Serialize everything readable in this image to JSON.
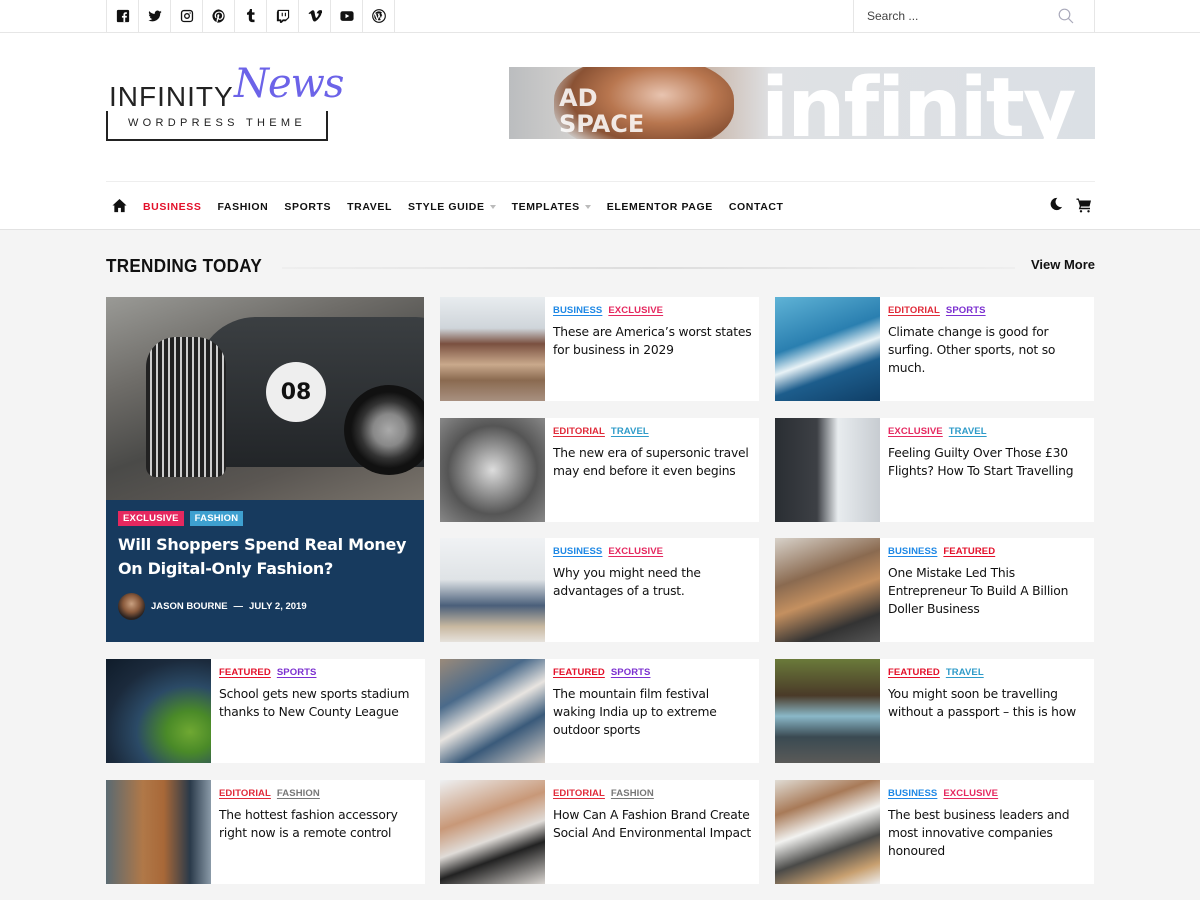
{
  "topbar": {
    "social": [
      {
        "name": "facebook-icon"
      },
      {
        "name": "twitter-icon"
      },
      {
        "name": "instagram-icon"
      },
      {
        "name": "pinterest-icon"
      },
      {
        "name": "tumblr-icon"
      },
      {
        "name": "twitch-icon"
      },
      {
        "name": "vimeo-icon"
      },
      {
        "name": "youtube-icon"
      },
      {
        "name": "wordpress-icon"
      }
    ],
    "search": {
      "placeholder": "Search ...",
      "icon": "search-icon"
    }
  },
  "logo": {
    "word1": "INFINITY",
    "word2": "News",
    "tagline": "WORDPRESS THEME"
  },
  "ad": {
    "line1": "AD",
    "line2": "SPACE",
    "brand": "infinity"
  },
  "nav": {
    "items": [
      {
        "label": "BUSINESS",
        "active": true,
        "dropdown": false
      },
      {
        "label": "FASHION",
        "active": false,
        "dropdown": false
      },
      {
        "label": "SPORTS",
        "active": false,
        "dropdown": false
      },
      {
        "label": "TRAVEL",
        "active": false,
        "dropdown": false
      },
      {
        "label": "STYLE GUIDE",
        "active": false,
        "dropdown": true
      },
      {
        "label": "TEMPLATES",
        "active": false,
        "dropdown": true
      },
      {
        "label": "ELEMENTOR PAGE",
        "active": false,
        "dropdown": false
      },
      {
        "label": "CONTACT",
        "active": false,
        "dropdown": false
      }
    ],
    "active_color": "#e3102a"
  },
  "section": {
    "title": "TRENDING TODAY",
    "view_more": "View More"
  },
  "category_colors": {
    "BUSINESS": "#1e88e5",
    "EXCLUSIVE": "#e5285f",
    "EDITORIAL": "#e02b3a",
    "SPORTS": "#7b2fd0",
    "TRAVEL": "#2e9bc9",
    "FEATURED": "#e3102a",
    "FASHION": "#777777"
  },
  "featured": {
    "plate": "08",
    "categories": [
      {
        "label": "EXCLUSIVE",
        "color": "#e5285f"
      },
      {
        "label": "FASHION",
        "color": "#3ea0d0"
      }
    ],
    "title": "Will Shoppers Spend Real Money On Digital-Only Fashion?",
    "author": "JASON BOURNE",
    "separator": "—",
    "date": "JULY 2, 2019"
  },
  "cards": [
    {
      "cats": [
        "BUSINESS",
        "EXCLUSIVE"
      ],
      "title": "These are America’s worst states for business in 2029"
    },
    {
      "cats": [
        "EDITORIAL",
        "SPORTS"
      ],
      "title": "Climate change is good for surfing. Other sports, not so much."
    },
    {
      "cats": [
        "EDITORIAL",
        "TRAVEL"
      ],
      "title": "The new era of supersonic travel may end before it even begins"
    },
    {
      "cats": [
        "EXCLUSIVE",
        "TRAVEL"
      ],
      "title": "Feeling Guilty Over Those £30 Flights? How To Start Travelling"
    },
    {
      "cats": [
        "BUSINESS",
        "EXCLUSIVE"
      ],
      "title": "Why you might need the advantages of a trust."
    },
    {
      "cats": [
        "BUSINESS",
        "FEATURED"
      ],
      "title": "One Mistake Led This Entrepreneur To Build A Billion Doller Business"
    },
    {
      "cats": [
        "FEATURED",
        "SPORTS"
      ],
      "title": "School gets new sports stadium thanks to New County League"
    },
    {
      "cats": [
        "FEATURED",
        "SPORTS"
      ],
      "title": "The mountain film festival waking India up to extreme outdoor sports"
    },
    {
      "cats": [
        "FEATURED",
        "TRAVEL"
      ],
      "title": "You might soon be travelling without a passport – this is how"
    },
    {
      "cats": [
        "EDITORIAL",
        "FASHION"
      ],
      "title": "The hottest fashion accessory right now is a remote control"
    },
    {
      "cats": [
        "EDITORIAL",
        "FASHION"
      ],
      "title": "How Can A Fashion Brand Create Social And Environmental Impact"
    },
    {
      "cats": [
        "BUSINESS",
        "EXCLUSIVE"
      ],
      "title": "The best business leaders and most innovative companies honoured"
    }
  ]
}
